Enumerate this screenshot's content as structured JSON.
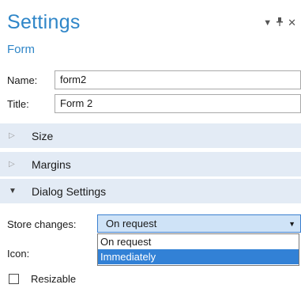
{
  "header": {
    "title": "Settings",
    "subtitle": "Form",
    "icons": [
      "dropdown-icon",
      "pin-icon",
      "close-icon"
    ]
  },
  "fields": {
    "name_label": "Name:",
    "name_value": "form2",
    "title_label": "Title:",
    "title_value": "Form 2"
  },
  "sections": {
    "size": "Size",
    "margins": "Margins",
    "dialog_settings": "Dialog Settings"
  },
  "dialog": {
    "store_changes_label": "Store changes:",
    "store_changes_value": "On request",
    "options": [
      "On request",
      "Immediately"
    ],
    "selected_option_index": 1,
    "icon_label": "Icon:",
    "resizable_label": "Resizable",
    "resizable_checked": false
  },
  "colors": {
    "accent": "#2f86c8",
    "section_bg": "#e3ebf5",
    "selection": "#3281d6"
  }
}
